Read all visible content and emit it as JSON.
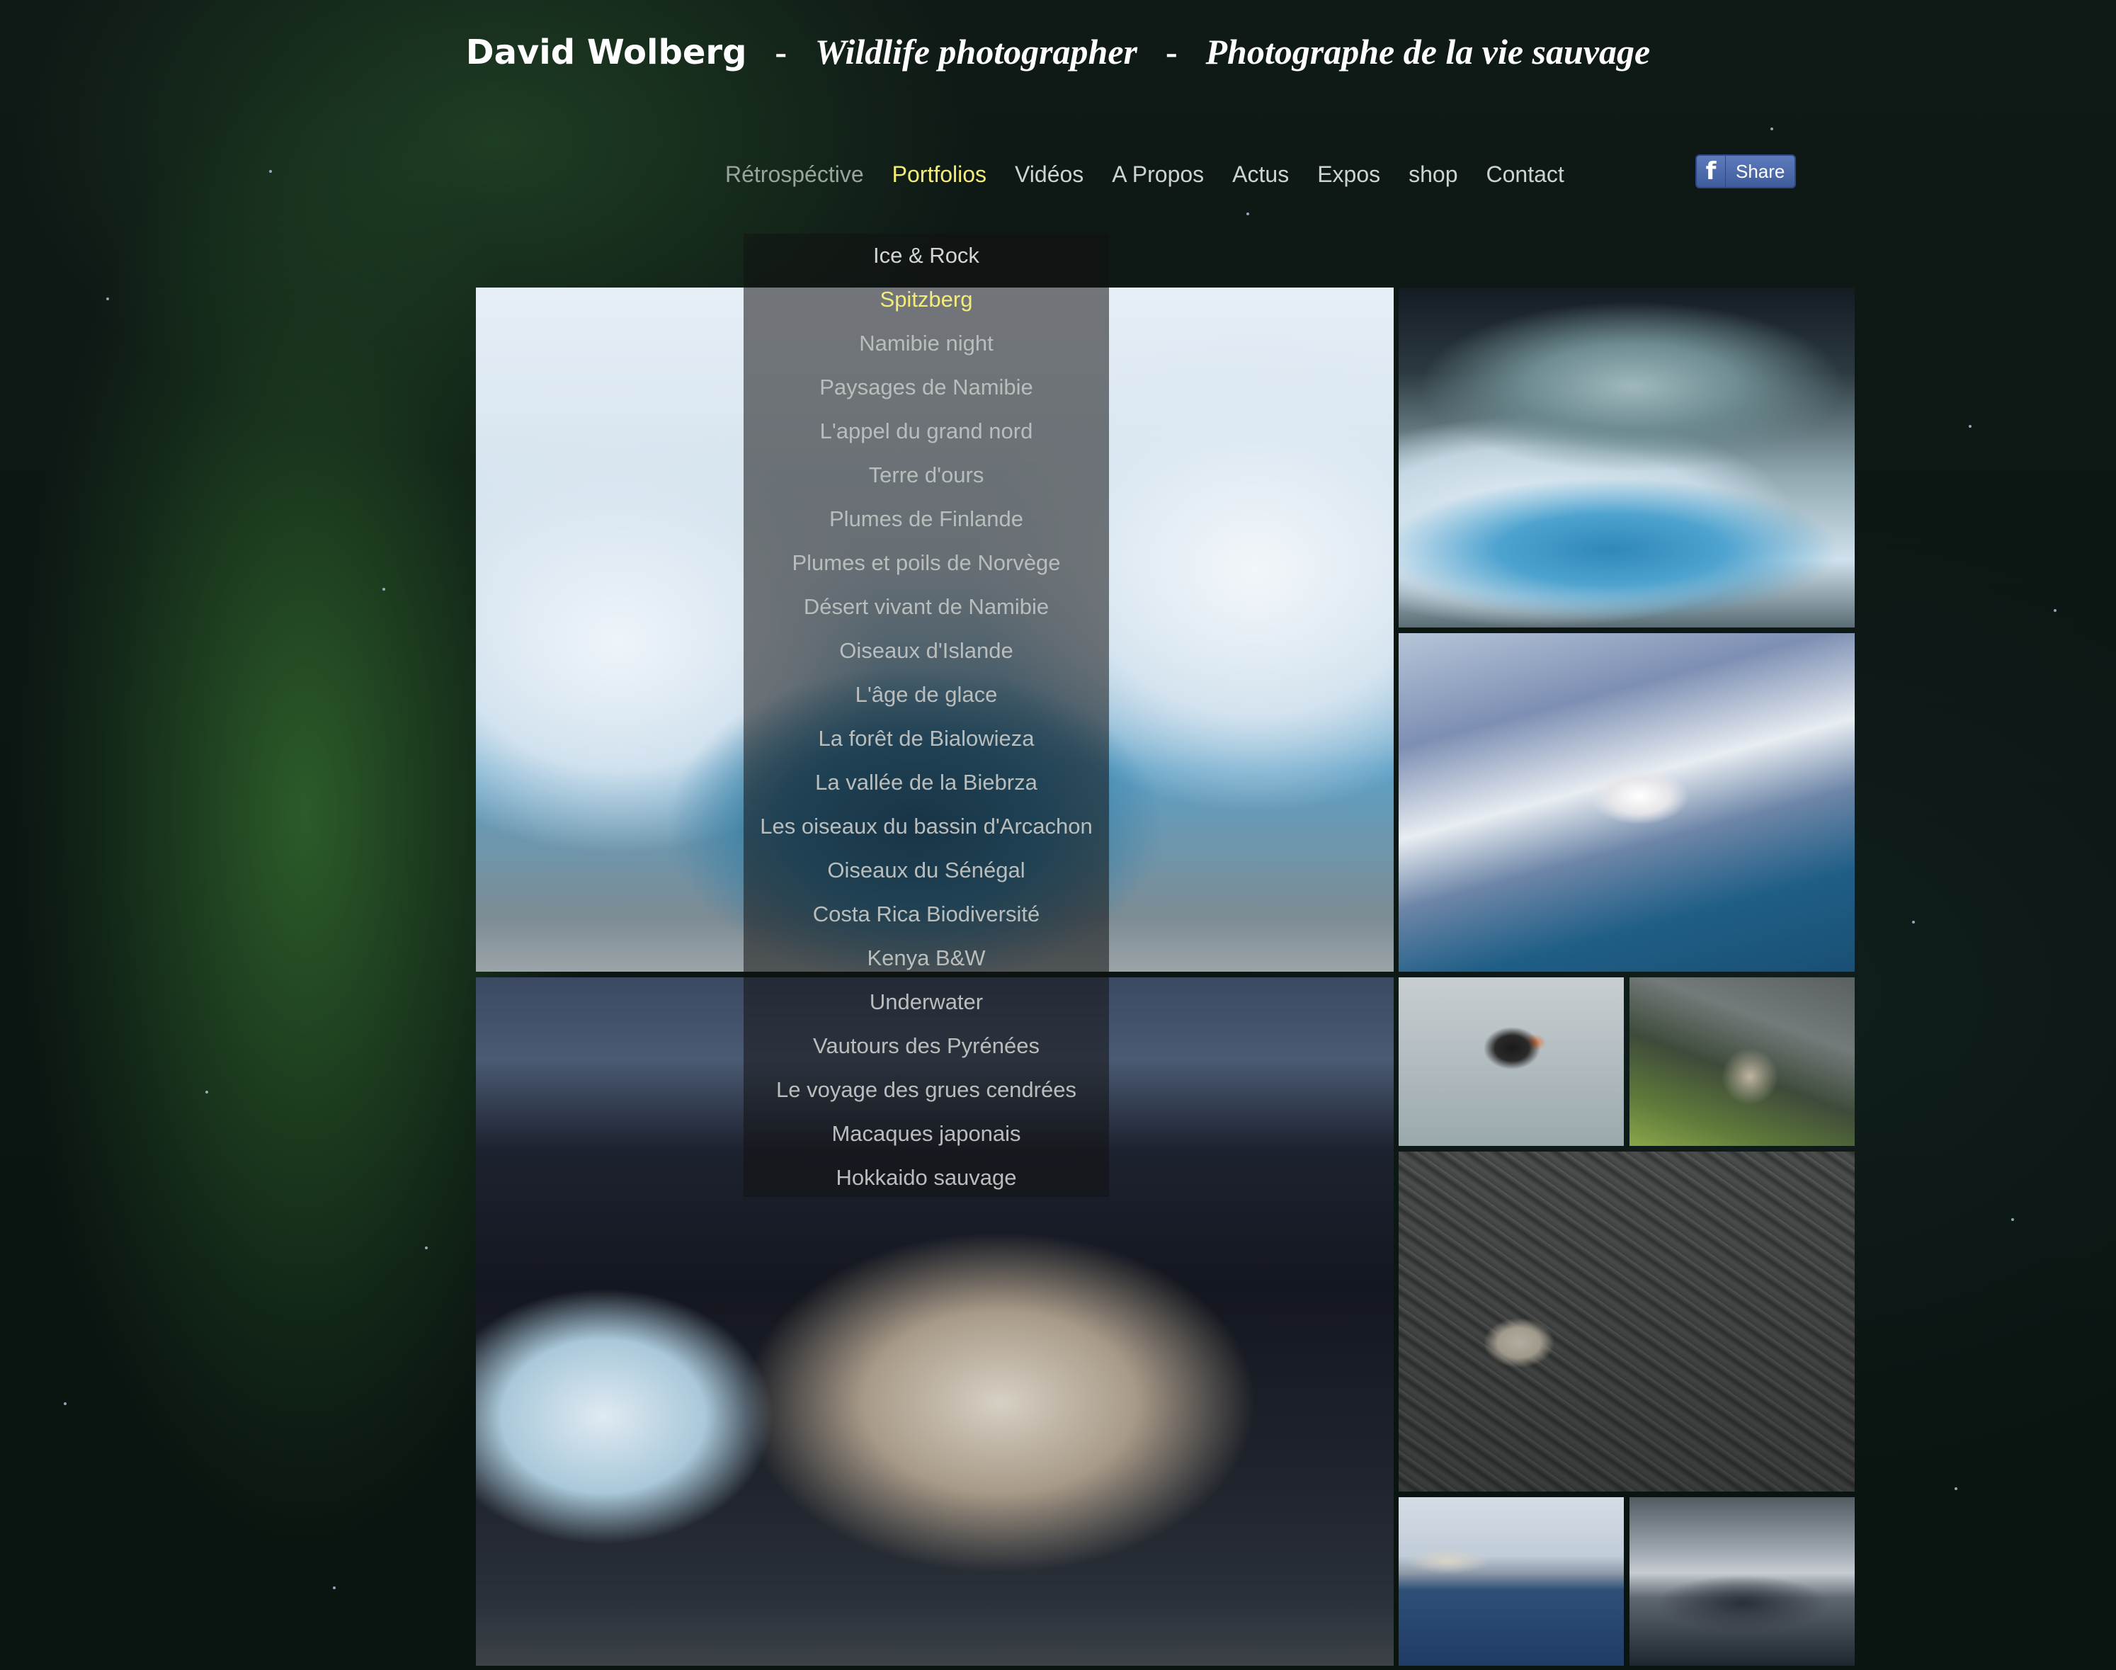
{
  "header": {
    "name": "David Wolberg",
    "separator": "-",
    "tagline_en": "Wildlife photographer",
    "tagline_fr": "Photographe de la vie sauvage"
  },
  "nav": {
    "items": [
      "Rétrospéctive",
      "Portfolios",
      "Vidéos",
      "A Propos",
      "Actus",
      "Expos",
      "shop",
      "Contact"
    ],
    "active": "Portfolios"
  },
  "share": {
    "icon": "f",
    "label": "Share"
  },
  "portfolios_menu": {
    "items": [
      "Ice & Rock",
      "Spitzberg",
      "Namibie night",
      "Paysages de Namibie",
      "L'appel du grand nord",
      "Terre d'ours",
      "Plumes de Finlande",
      "Plumes et poils de Norvège",
      "Désert vivant de Namibie",
      "Oiseaux d'Islande",
      "L'âge de glace",
      "La forêt de Bialowieza",
      "La vallée de la Biebrza",
      "Les oiseaux du bassin d'Arcachon",
      "Oiseaux du Sénégal",
      "Costa Rica Biodiversité",
      "Kenya B&W",
      "Underwater",
      "Vautours des Pyrénées",
      "Le voyage des grues cendrées",
      "Macaques japonais",
      "Hokkaido sauvage"
    ],
    "selected": "Spitzberg"
  },
  "colors": {
    "active_nav": "#f4ec7a",
    "facebook_blue": "#4a67a8"
  }
}
